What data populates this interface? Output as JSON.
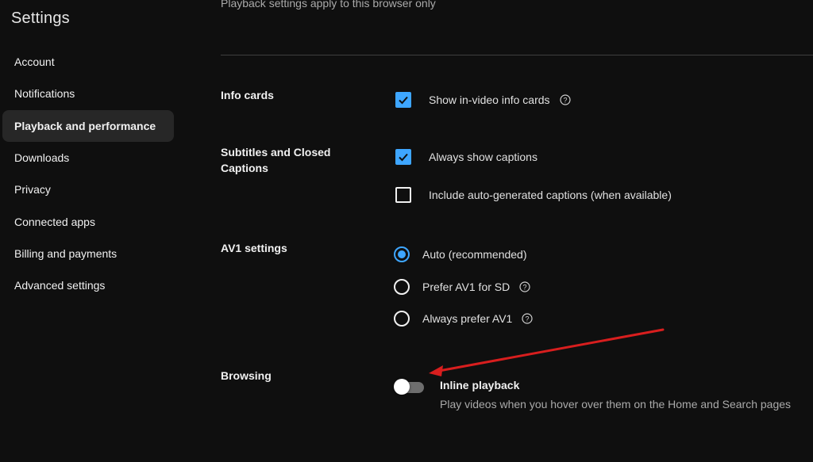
{
  "sidebar": {
    "title": "Settings",
    "items": [
      {
        "label": "Account"
      },
      {
        "label": "Notifications"
      },
      {
        "label": "Playback and performance",
        "active": true
      },
      {
        "label": "Downloads"
      },
      {
        "label": "Privacy"
      },
      {
        "label": "Connected apps"
      },
      {
        "label": "Billing and payments"
      },
      {
        "label": "Advanced settings"
      }
    ]
  },
  "main": {
    "top_note": "Playback settings apply to this browser only",
    "info_cards": {
      "label": "Info cards",
      "option": {
        "label": "Show in-video info cards",
        "checked": true,
        "icon": "help-icon"
      }
    },
    "subtitles": {
      "label": "Subtitles and Closed Captions",
      "options": [
        {
          "label": "Always show captions",
          "checked": true
        },
        {
          "label": "Include auto-generated captions (when available)",
          "checked": false
        }
      ]
    },
    "av1": {
      "label": "AV1 settings",
      "options": [
        {
          "label": "Auto (recommended)",
          "selected": true
        },
        {
          "label": "Prefer AV1 for SD",
          "selected": false,
          "icon": "help-icon"
        },
        {
          "label": "Always prefer AV1",
          "selected": false,
          "icon": "help-icon"
        }
      ]
    },
    "browsing": {
      "label": "Browsing",
      "toggle": {
        "title": "Inline playback",
        "description": "Play videos when you hover over them on the Home and Search pages",
        "on": false
      }
    }
  },
  "colors": {
    "background": "#0f0f0f",
    "accent": "#3ea6ff",
    "active_item": "#272727",
    "annotation_arrow": "#d81e1e"
  }
}
